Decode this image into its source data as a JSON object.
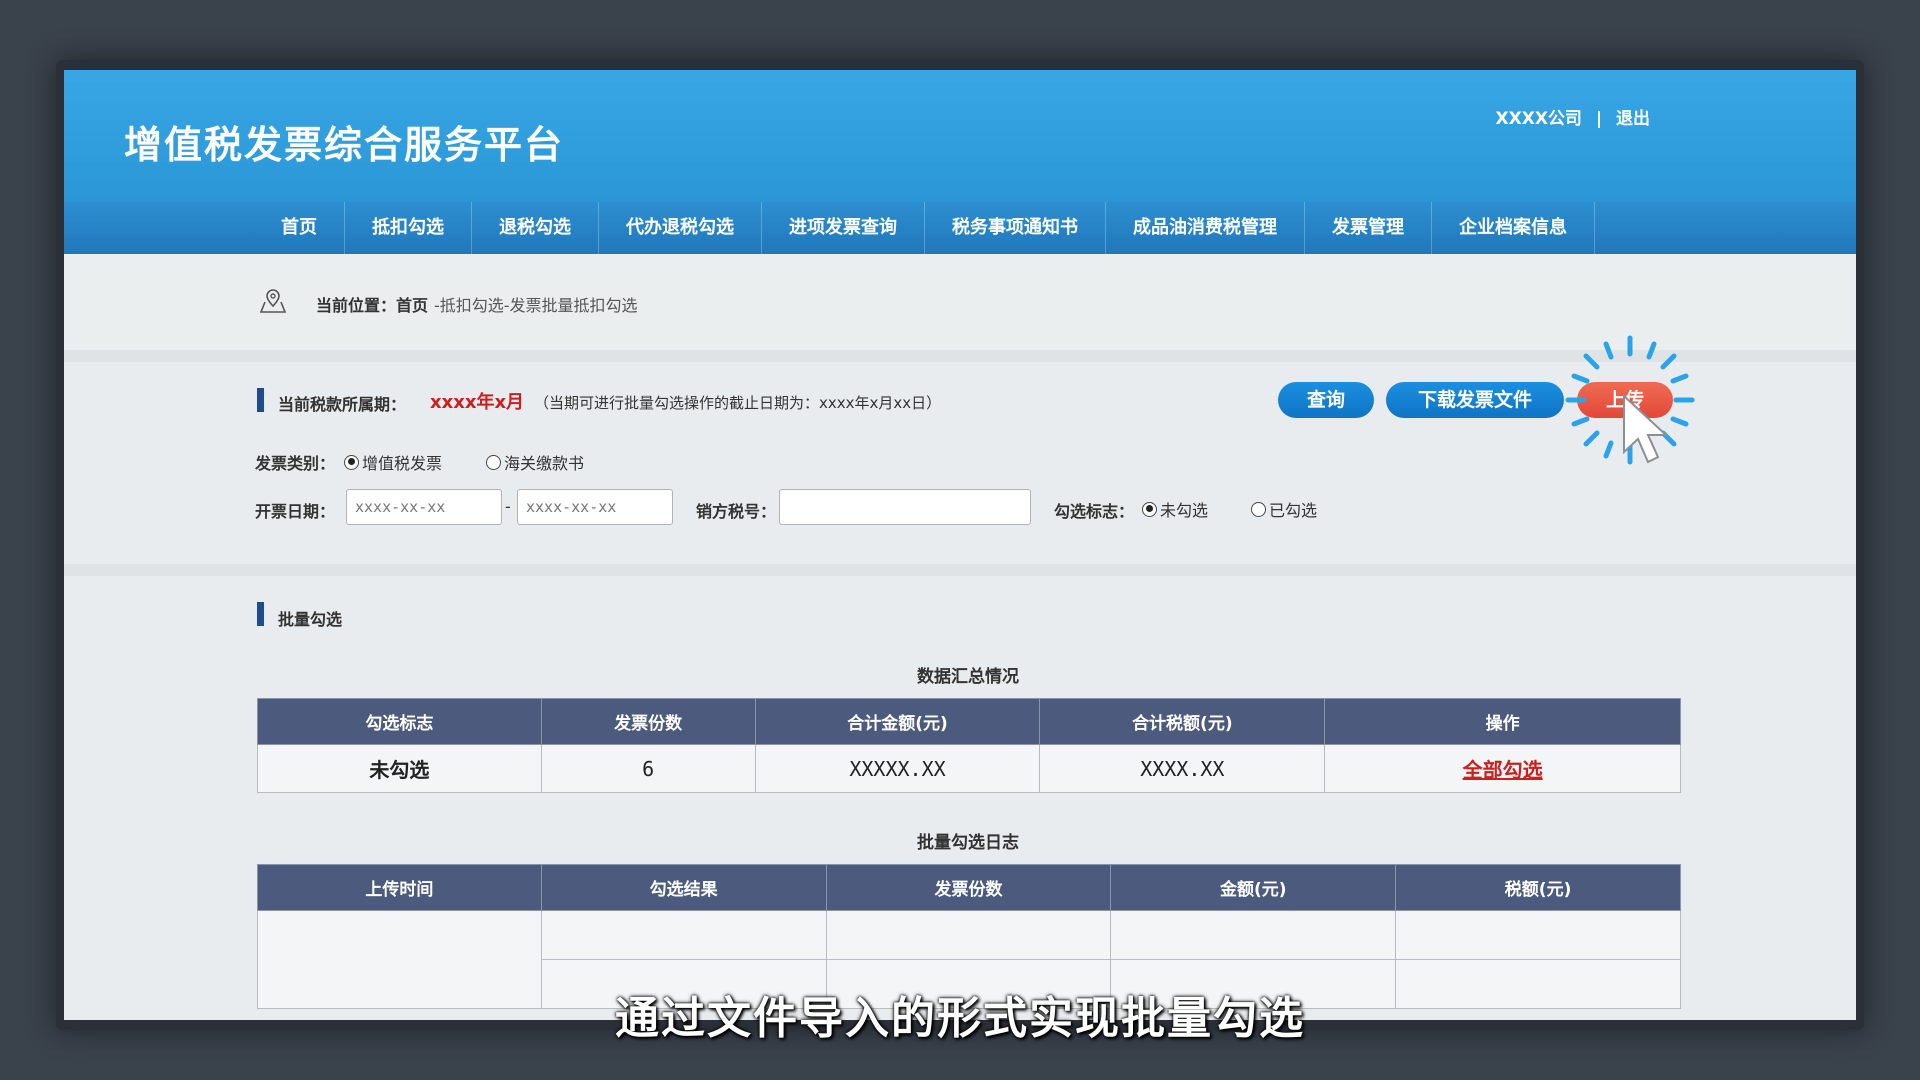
{
  "app": {
    "title": "增值税发票综合服务平台",
    "company": "XXXX公司",
    "separator": "|",
    "logout": "退出"
  },
  "nav": {
    "items": [
      {
        "label": "首页"
      },
      {
        "label": "抵扣勾选"
      },
      {
        "label": "退税勾选"
      },
      {
        "label": "代办退税勾选"
      },
      {
        "label": "进项发票查询"
      },
      {
        "label": "税务事项通知书"
      },
      {
        "label": "成品油消费税管理"
      },
      {
        "label": "发票管理"
      },
      {
        "label": "企业档案信息"
      }
    ]
  },
  "breadcrumb": {
    "icon": "location-pin-icon",
    "label": "当前位置：首页",
    "path": "-抵扣勾选-发票批量抵扣勾选"
  },
  "filter": {
    "period_label": "当前税款所属期：",
    "period_value": "xxxx年x月",
    "period_note": "（当期可进行批量勾选操作的截止日期为：xxxx年x月xx日）",
    "query_button": "查询",
    "download_button": "下载发票文件",
    "upload_button": "上传",
    "invoice_type_label": "发票类别：",
    "invoice_type_options": [
      {
        "label": "增值税发票",
        "checked": true
      },
      {
        "label": "海关缴款书",
        "checked": false
      }
    ],
    "date_label": "开票日期：",
    "date_from_placeholder": "xxxx-xx-xx",
    "date_to_placeholder": "xxxx-xx-xx",
    "date_sep": "-",
    "seller_tax_label": "销方税号：",
    "seller_tax_value": "",
    "check_flag_label": "勾选标志：",
    "check_flag_options": [
      {
        "label": "未勾选",
        "checked": true
      },
      {
        "label": "已勾选",
        "checked": false
      }
    ]
  },
  "batch": {
    "section_title": "批量勾选",
    "summary_caption": "数据汇总情况",
    "summary_headers": [
      "勾选标志",
      "发票份数",
      "合计金额(元)",
      "合计税额(元)",
      "操作"
    ],
    "summary_row": {
      "flag": "未勾选",
      "count": "6",
      "amount": "XXXXX.XX",
      "tax": "XXXX.XX",
      "action": "全部勾选"
    },
    "log_caption": "批量勾选日志",
    "log_headers": [
      "上传时间",
      "勾选结果",
      "发票份数",
      "金额(元)",
      "税额(元)"
    ]
  },
  "subtitle": "通过文件导入的形式实现批量勾选",
  "colors": {
    "header_blue": "#2a96d6",
    "nav_blue": "#1f78bb",
    "table_header": "#4c5b7d",
    "accent_red": "#cc1f1f",
    "upload_red": "#e2483a"
  }
}
